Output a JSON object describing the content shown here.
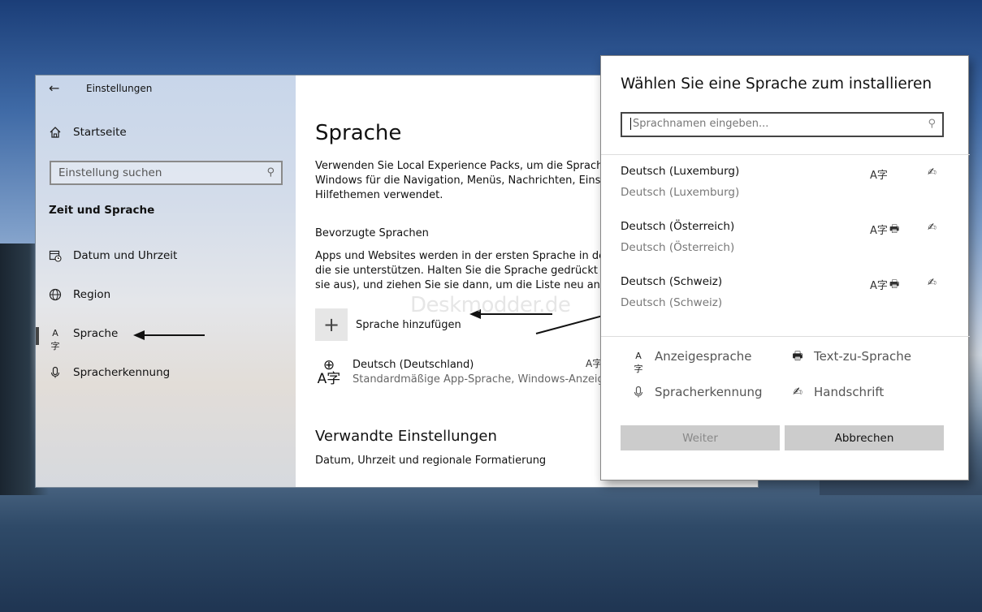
{
  "settings": {
    "app_title": "Einstellungen",
    "nav_home": "Startseite",
    "search_placeholder": "Einstellung suchen",
    "section_title": "Zeit und Sprache",
    "nav_items": [
      {
        "label": "Datum und Uhrzeit",
        "icon": "calendar-clock-icon"
      },
      {
        "label": "Region",
        "icon": "globe-icon"
      },
      {
        "label": "Sprache",
        "icon": "language-icon",
        "selected": true
      },
      {
        "label": "Spracherkennung",
        "icon": "microphone-icon"
      }
    ]
  },
  "content": {
    "page_title": "Sprache",
    "intro_line1": "Verwenden Sie Local Experience Packs, um die Sprache zu",
    "intro_line2": "Windows für die Navigation, Menüs, Nachrichten, Einstell",
    "intro_line3": "Hilfethemen verwendet.",
    "preferred_heading": "Bevorzugte Sprachen",
    "preferred_line1": "Apps und Websites werden in der ersten Sprache in der L",
    "preferred_line2": "die sie unterstützen. Halten Sie die Sprache gedrückt (od",
    "preferred_line3": "sie aus), und ziehen Sie sie dann, um die Liste neu anzuor",
    "add_language": "Sprache hinzufügen",
    "installed_language": {
      "name": "Deutsch (Deutschland)",
      "subtitle": "Standardmäßige App-Sprache, Windows-Anzeige"
    },
    "related_heading": "Verwandte Einstellungen",
    "related_link": "Datum, Uhrzeit und regionale Formatierung"
  },
  "dialog": {
    "title": "Wählen Sie eine Sprache zum installieren",
    "search_placeholder": "Sprachnamen eingeben...",
    "languages": [
      {
        "name": "Deutsch (Luxemburg)",
        "native": "Deutsch (Luxemburg)",
        "features": [
          "display",
          "handwriting"
        ]
      },
      {
        "name": "Deutsch (Österreich)",
        "native": "Deutsch (Österreich)",
        "features": [
          "display",
          "tts",
          "handwriting"
        ]
      },
      {
        "name": "Deutsch (Schweiz)",
        "native": "Deutsch (Schweiz)",
        "features": [
          "display",
          "tts",
          "handwriting"
        ]
      }
    ],
    "legend": {
      "display": "Anzeigesprache",
      "tts": "Text-zu-Sprache",
      "speech": "Spracherkennung",
      "handwriting": "Handschrift"
    },
    "btn_next": "Weiter",
    "btn_cancel": "Abbrechen"
  },
  "watermark": "Deskmodder.de"
}
